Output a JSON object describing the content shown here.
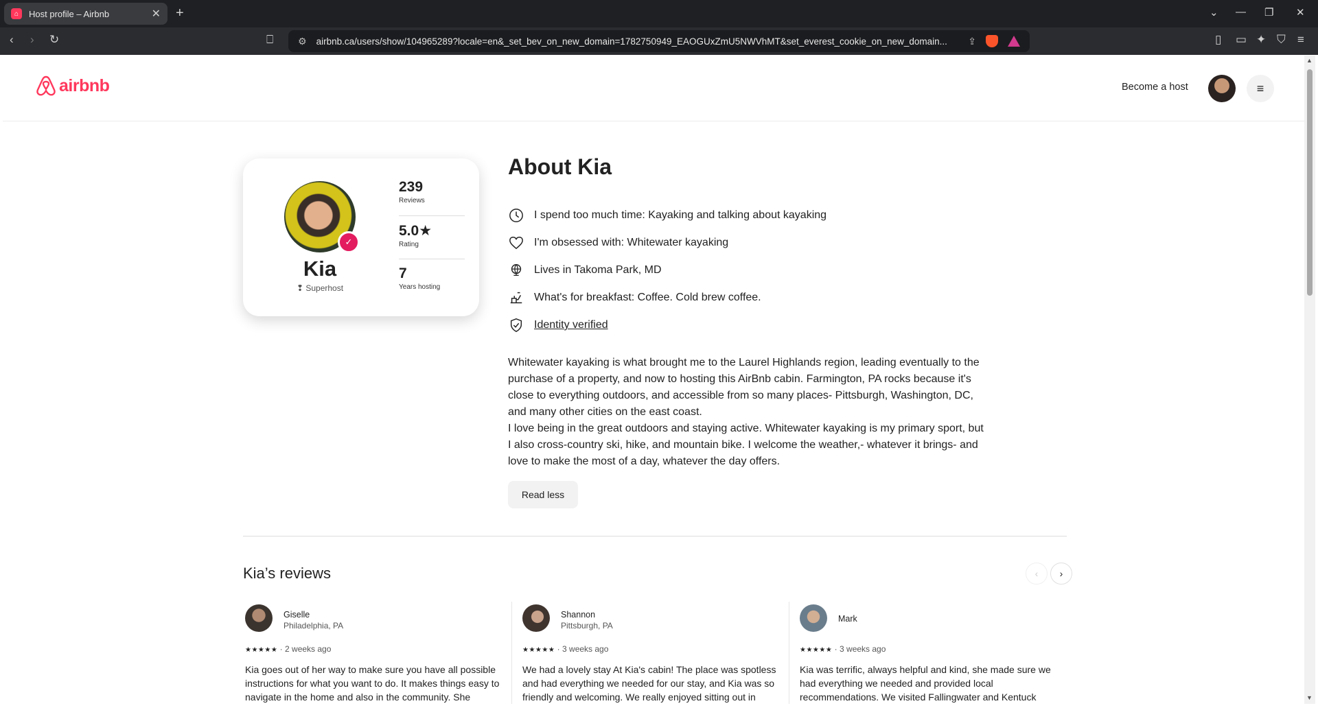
{
  "browser": {
    "tab_title": "Host profile – Airbnb",
    "url": "airbnb.ca/users/show/104965289?locale=en&_set_bev_on_new_domain=1782750949_EAOGUxZmU5NWVhMT&set_everest_cookie_on_new_domain..."
  },
  "header": {
    "logo_text": "airbnb",
    "become_host": "Become a host"
  },
  "profile": {
    "name": "Kia",
    "badge": "Superhost",
    "stats": [
      {
        "value": "239",
        "label": "Reviews"
      },
      {
        "value": "5.0★",
        "label": "Rating"
      },
      {
        "value": "7",
        "label": "Years hosting"
      }
    ]
  },
  "about": {
    "title": "About Kia",
    "facts": [
      {
        "icon": "clock-icon",
        "text": "I spend too much time: Kayaking and talking about kayaking"
      },
      {
        "icon": "heart-icon",
        "text": "I'm obsessed with: Whitewater kayaking"
      },
      {
        "icon": "globe-icon",
        "text": "Lives in Takoma Park, MD"
      },
      {
        "icon": "breakfast-icon",
        "text": "What's for breakfast: Coffee. Cold brew coffee."
      },
      {
        "icon": "shield-check-icon",
        "text": "Identity verified"
      }
    ],
    "bio_1": "Whitewater kayaking is what brought me to the Laurel Highlands region, leading eventually to the purchase of a property, and now to hosting this AirBnb cabin. Farmington, PA rocks because it's close to everything outdoors, and accessible from so many places- Pittsburgh, Washington, DC, and many other cities on the east coast.",
    "bio_2": "I love being in the great outdoors and staying active. Whitewater kayaking is my primary sport, but I also cross-country ski, hike, and mountain bike. I welcome the weather,- whatever it brings- and love to make the most of a day, whatever the day offers.",
    "read_less": "Read less"
  },
  "reviews": {
    "title": "Kia’s reviews",
    "items": [
      {
        "name": "Giselle",
        "location": "Philadelphia, PA",
        "stars": "★★★★★",
        "when": "2 weeks ago",
        "text": "Kia goes out of her way to make sure you have all possible instructions for what you want to do. It makes things easy to navigate in the home and also in the community. She"
      },
      {
        "name": "Shannon",
        "location": "Pittsburgh, PA",
        "stars": "★★★★★",
        "when": "3 weeks ago",
        "text": "We had a lovely stay At Kia's cabin! The place was spotless and had everything we needed for our stay, and Kia was so friendly and welcoming. We really enjoyed sitting out in"
      },
      {
        "name": "Mark",
        "location": "",
        "stars": "★★★★★",
        "when": "3 weeks ago",
        "text": "Kia was terrific, always helpful and kind, she made sure we had everything we needed and provided local recommendations.  We visited Fallingwater and Kentuck"
      }
    ]
  },
  "colors": {
    "brand": "#ff385c",
    "badge": "#e31c5f",
    "text": "#222222"
  }
}
